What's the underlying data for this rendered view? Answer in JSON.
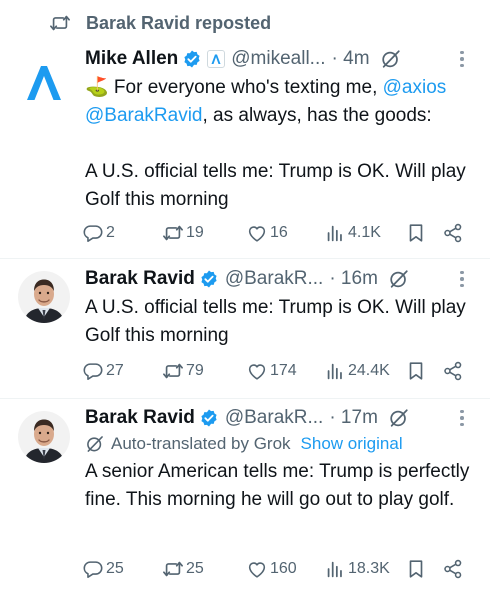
{
  "repost_banner": {
    "text": "Barak Ravid reposted",
    "icon": "repost-icon"
  },
  "colors": {
    "link": "#1d9bf0",
    "secondary_text": "#536471",
    "verified": "#1d9bf0",
    "affiliation_badge": "#1d9bf0",
    "axios_logo": "#1d9bf0"
  },
  "tweets": [
    {
      "name": "Mike Allen",
      "handle": "@mikeall...",
      "time": "· 4m",
      "badges": [
        "verified-badge",
        "axios-affiliation-badge",
        "grok-icon"
      ],
      "body": {
        "part1": "⛳ For everyone who's texting me, ",
        "mention1": "@axios",
        "mention2": "@BarakRavid",
        "part2": ", as always, has the goods:",
        "part3": "A U.S. official tells me: Trump is OK. Will play Golf this morning"
      },
      "stats": {
        "replies": "2",
        "reposts": "19",
        "likes": "16",
        "views": "4.1K"
      }
    },
    {
      "name": "Barak Ravid",
      "handle": "@BarakR...",
      "time": "· 16m",
      "badges": [
        "verified-badge",
        "grok-icon"
      ],
      "body": {
        "text": "A U.S. official tells me: Trump is OK. Will play Golf this morning"
      },
      "stats": {
        "replies": "27",
        "reposts": "79",
        "likes": "174",
        "views": "24.4K"
      }
    },
    {
      "name": "Barak Ravid",
      "handle": "@BarakR...",
      "time": "· 17m",
      "badges": [
        "verified-badge",
        "grok-icon"
      ],
      "translation": {
        "label": "Auto-translated by Grok",
        "show_original": "Show original"
      },
      "body": {
        "text": "A senior American tells me: Trump is perfectly fine. This morning he will go out to play golf."
      },
      "stats": {
        "replies": "25",
        "reposts": "25",
        "likes": "160",
        "views": "18.3K"
      }
    }
  ]
}
